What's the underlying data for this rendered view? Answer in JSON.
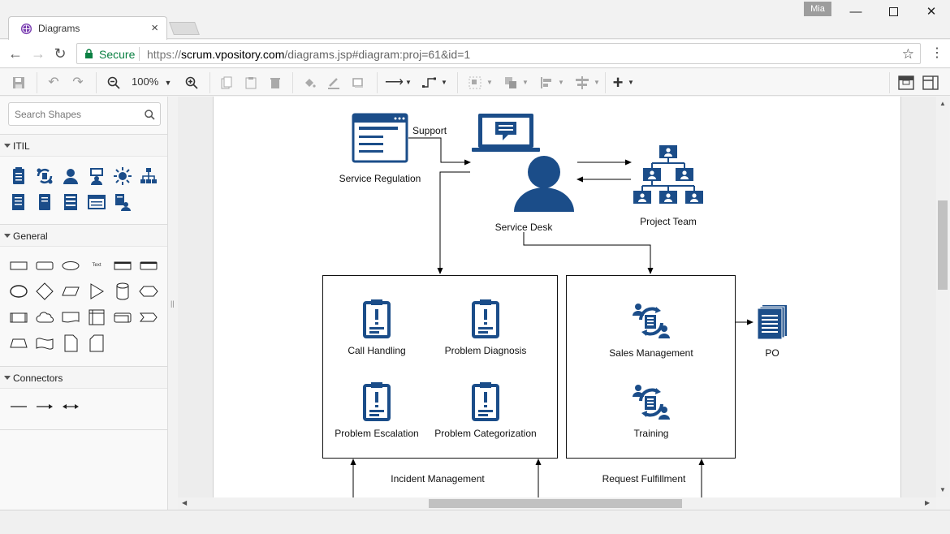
{
  "browser": {
    "tab_title": "Diagrams",
    "profile_name": "Mia",
    "secure_label": "Secure",
    "url_scheme": "https://",
    "url_domain": "scrum.vpository.com",
    "url_path": "/diagrams.jsp#diagram:proj=61&id=1"
  },
  "toolbar": {
    "zoom": "100%"
  },
  "sidebar": {
    "search_placeholder": "Search Shapes",
    "sections": [
      {
        "label": "ITIL"
      },
      {
        "label": "General"
      },
      {
        "label": "Connectors"
      }
    ],
    "general_text_shape": "Text"
  },
  "diagram": {
    "nodes": {
      "service_regulation": "Service Regulation",
      "service_desk": "Service Desk",
      "project_team": "Project Team",
      "call_handling": "Call Handling",
      "problem_diagnosis": "Problem Diagnosis",
      "problem_escalation": "Problem Escalation",
      "problem_categorization": "Problem Categorization",
      "sales_management": "Sales Management",
      "training": "Training",
      "po": "PO"
    },
    "edge_labels": {
      "support": "Support",
      "incident_management": "Incident Management",
      "request_fulfillment": "Request Fulfillment"
    },
    "icon_color": "#1b4d89"
  },
  "colors": {
    "brand_blue": "#1b4d89",
    "secure_green": "#0b8043"
  }
}
